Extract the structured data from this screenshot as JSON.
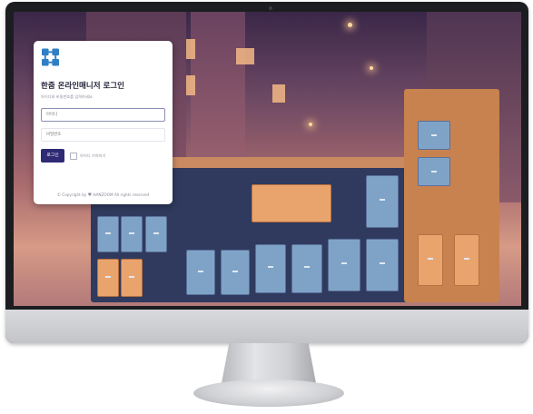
{
  "login": {
    "logo_icon": "grid-logo-icon",
    "title": "한줌 온라인매니저 로그인",
    "subtitle": "아이디와 비밀번호를 입력하세요.",
    "id_field": {
      "placeholder": "아이디",
      "value": ""
    },
    "password_field": {
      "placeholder": "비밀번호",
      "value": ""
    },
    "login_button": "로그인",
    "remember_label": "아이디 기억하기",
    "remember_checked": false,
    "copyright_prefix": "© Copyright by",
    "copyright_suffix": "HANZOOM All rights reserved",
    "heart_icon": "heart-icon"
  },
  "colors": {
    "primary": "#2e2a74",
    "logo": "#2f7fc4",
    "monitor_frame": "#1c1d21",
    "monitor_chin": "#d0d1d4"
  }
}
